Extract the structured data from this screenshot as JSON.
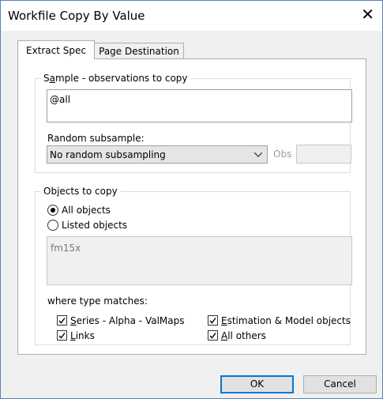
{
  "window": {
    "title": "Workfile Copy By Value",
    "close_glyph": "✕"
  },
  "tabs": [
    {
      "label": "Extract Spec",
      "active": true
    },
    {
      "label": "Page Destination",
      "active": false
    }
  ],
  "sample": {
    "group_label_pre": "S",
    "group_label_ul": "a",
    "group_label_post": "mple - observations to copy",
    "value": "@all",
    "random_label": "Random subsample:",
    "random_value": "No random subsampling",
    "obs_label": "Obs",
    "obs_value": ""
  },
  "objects": {
    "group_label": "Objects to copy",
    "radio_all": "All objects",
    "radio_listed": "Listed objects",
    "selected": "all",
    "listed_value": "fm15x",
    "type_label": "where type matches:",
    "cb_series_ul": "S",
    "cb_series_rest": "eries - Alpha - ValMaps",
    "cb_links_ul": "L",
    "cb_links_rest": "inks",
    "cb_estimation_ul": "E",
    "cb_estimation_rest": "stimation & Model objects",
    "cb_allothers_ul": "A",
    "cb_allothers_rest": "ll others",
    "checked": {
      "series": true,
      "links": true,
      "estimation": true,
      "allothers": true
    }
  },
  "buttons": {
    "ok": "OK",
    "cancel": "Cancel"
  },
  "colors": {
    "focus_border": "#0078d7",
    "window_border": "#5a7fb8"
  }
}
